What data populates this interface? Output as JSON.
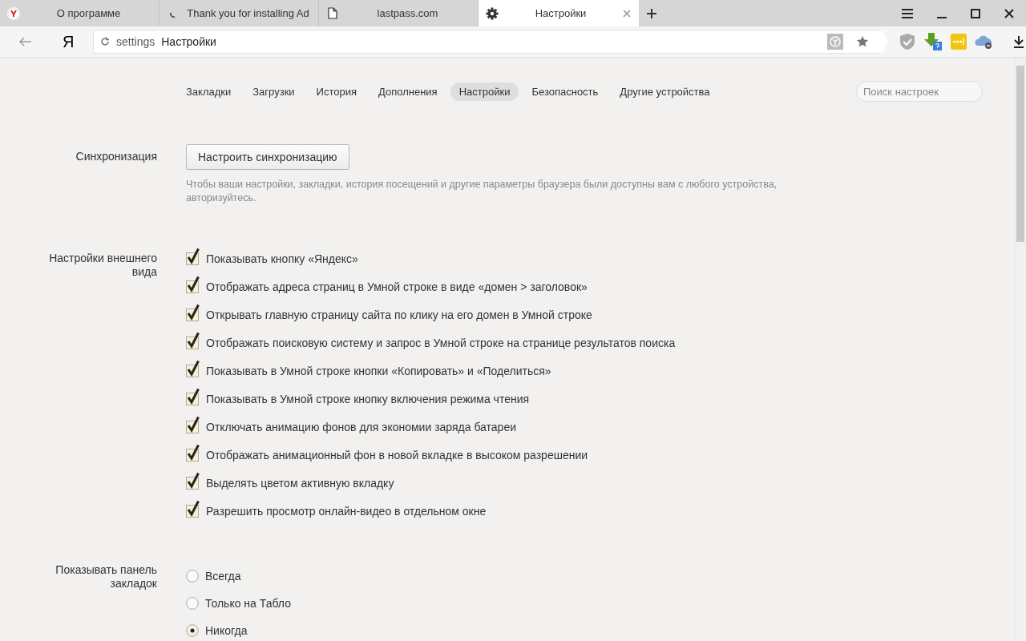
{
  "tabs": [
    {
      "title": "О программе",
      "selected": false
    },
    {
      "title": "Thank you for installing Ad",
      "selected": false
    },
    {
      "title": "lastpass.com",
      "selected": false
    },
    {
      "title": "Настройки",
      "selected": true
    }
  ],
  "address_bar": {
    "logo": "Я",
    "scheme": "settings",
    "title": "Настройки"
  },
  "nav": [
    {
      "label": "Закладки",
      "selected": false
    },
    {
      "label": "Загрузки",
      "selected": false
    },
    {
      "label": "История",
      "selected": false
    },
    {
      "label": "Дополнения",
      "selected": false
    },
    {
      "label": "Настройки",
      "selected": true
    },
    {
      "label": "Безопасность",
      "selected": false
    },
    {
      "label": "Другие устройства",
      "selected": false
    }
  ],
  "search": {
    "placeholder": "Поиск настроек"
  },
  "sections": [
    {
      "kind": "button",
      "label": "Синхронизация",
      "button": "Настроить синхронизацию",
      "hint": "Чтобы ваши настройки, закладки, история посещений и другие параметры браузера были доступны вам с любого устройства, авторизуйтесь."
    },
    {
      "kind": "checkboxes",
      "label": "Настройки внешнего вида",
      "options": [
        {
          "label": "Показывать кнопку «Яндекс»",
          "checked": true
        },
        {
          "label": "Отображать адреса страниц в Умной строке в виде «домен > заголовок»",
          "checked": true
        },
        {
          "label": "Открывать главную страницу сайта по клику на его домен в Умной строке",
          "checked": true
        },
        {
          "label": "Отображать поисковую систему и запрос в Умной строке на странице результатов поиска",
          "checked": true
        },
        {
          "label": "Показывать в Умной строке кнопки «Копировать» и «Поделиться»",
          "checked": true
        },
        {
          "label": "Показывать в Умной строке кнопку включения режима чтения",
          "checked": true
        },
        {
          "label": "Отключать анимацию фонов для экономии заряда батареи",
          "checked": true
        },
        {
          "label": "Отображать анимационный фон в новой вкладке в высоком разрешении",
          "checked": true
        },
        {
          "label": "Выделять цветом активную вкладку",
          "checked": true
        },
        {
          "label": "Разрешить просмотр онлайн-видео в отдельном окне",
          "checked": true
        }
      ]
    },
    {
      "kind": "radios",
      "label": "Показывать панель закладок",
      "options": [
        {
          "label": "Всегда",
          "selected": false
        },
        {
          "label": "Только на Табло",
          "selected": false
        },
        {
          "label": "Никогда",
          "selected": true
        }
      ]
    }
  ]
}
